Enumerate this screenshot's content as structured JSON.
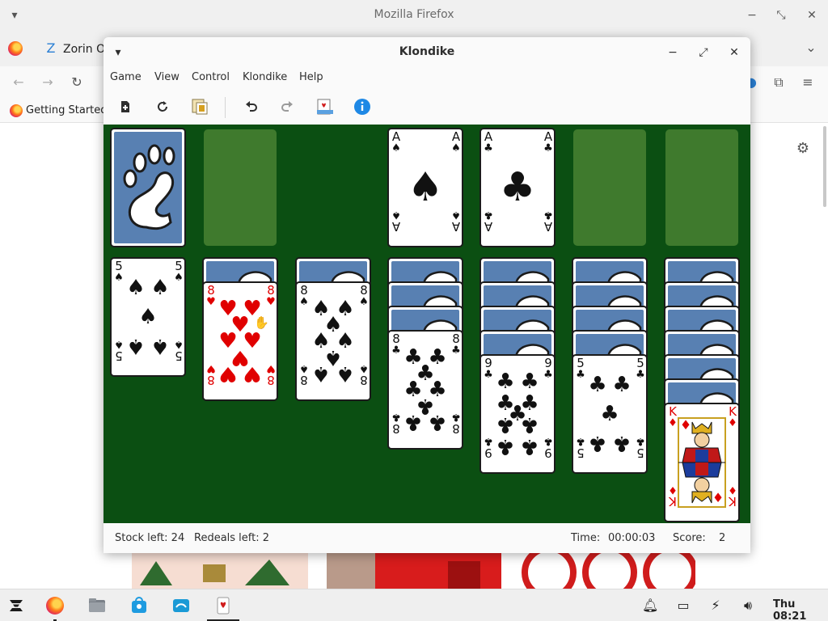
{
  "browser": {
    "window_title": "Mozilla Firefox",
    "tab_label": "Zorin OS",
    "bookmark_label": "Getting Started"
  },
  "solitaire": {
    "window_title": "Klondike",
    "menu": [
      "Game",
      "View",
      "Control",
      "Klondike",
      "Help"
    ],
    "toolbar": [
      "new-game-icon",
      "restart-icon",
      "select-deck-icon",
      "undo-icon",
      "redo-icon",
      "hint-icon",
      "info-icon"
    ],
    "status": {
      "stock_left": "Stock left: 24",
      "redeals_left": "Redeals left: 2",
      "time_label": "Time:",
      "time_value": "00:00:03",
      "score_label": "Score:",
      "score_value": "2"
    },
    "colors": {
      "felt": "#0b4f12",
      "empty_slot": "#3f7a2d",
      "card_back": "#5880b2",
      "red_suit": "#e00000"
    },
    "top_row": [
      {
        "name": "stock-pile",
        "type": "stock-back"
      },
      {
        "name": "waste-pile",
        "type": "empty"
      },
      {
        "name": "spacer",
        "type": "none"
      },
      {
        "name": "foundation-1",
        "type": "card",
        "rank": "A",
        "suit": "♠",
        "color": "black"
      },
      {
        "name": "foundation-2",
        "type": "card",
        "rank": "A",
        "suit": "♣",
        "color": "black"
      },
      {
        "name": "foundation-3",
        "type": "empty"
      },
      {
        "name": "foundation-4",
        "type": "empty"
      }
    ],
    "tableau": [
      {
        "hidden": 0,
        "face_up": [
          {
            "rank": "5",
            "suit": "♠",
            "color": "black"
          }
        ]
      },
      {
        "hidden": 1,
        "face_up": [
          {
            "rank": "8",
            "suit": "♥",
            "color": "red"
          }
        ]
      },
      {
        "hidden": 1,
        "face_up": [
          {
            "rank": "8",
            "suit": "♠",
            "color": "black"
          }
        ]
      },
      {
        "hidden": 3,
        "face_up": [
          {
            "rank": "8",
            "suit": "♣",
            "color": "black"
          }
        ]
      },
      {
        "hidden": 4,
        "face_up": [
          {
            "rank": "9",
            "suit": "♣",
            "color": "black"
          }
        ]
      },
      {
        "hidden": 4,
        "face_up": [
          {
            "rank": "5",
            "suit": "♣",
            "color": "black"
          }
        ]
      },
      {
        "hidden": 6,
        "face_up": [
          {
            "rank": "K",
            "suit": "♦",
            "color": "red",
            "court": true
          }
        ]
      }
    ]
  },
  "taskbar": {
    "apps": [
      "zorin-menu-icon",
      "firefox-icon",
      "files-icon",
      "software-store-icon",
      "zorin-connect-icon",
      "aisleriot-icon"
    ],
    "clock": "Thu 08:21"
  }
}
